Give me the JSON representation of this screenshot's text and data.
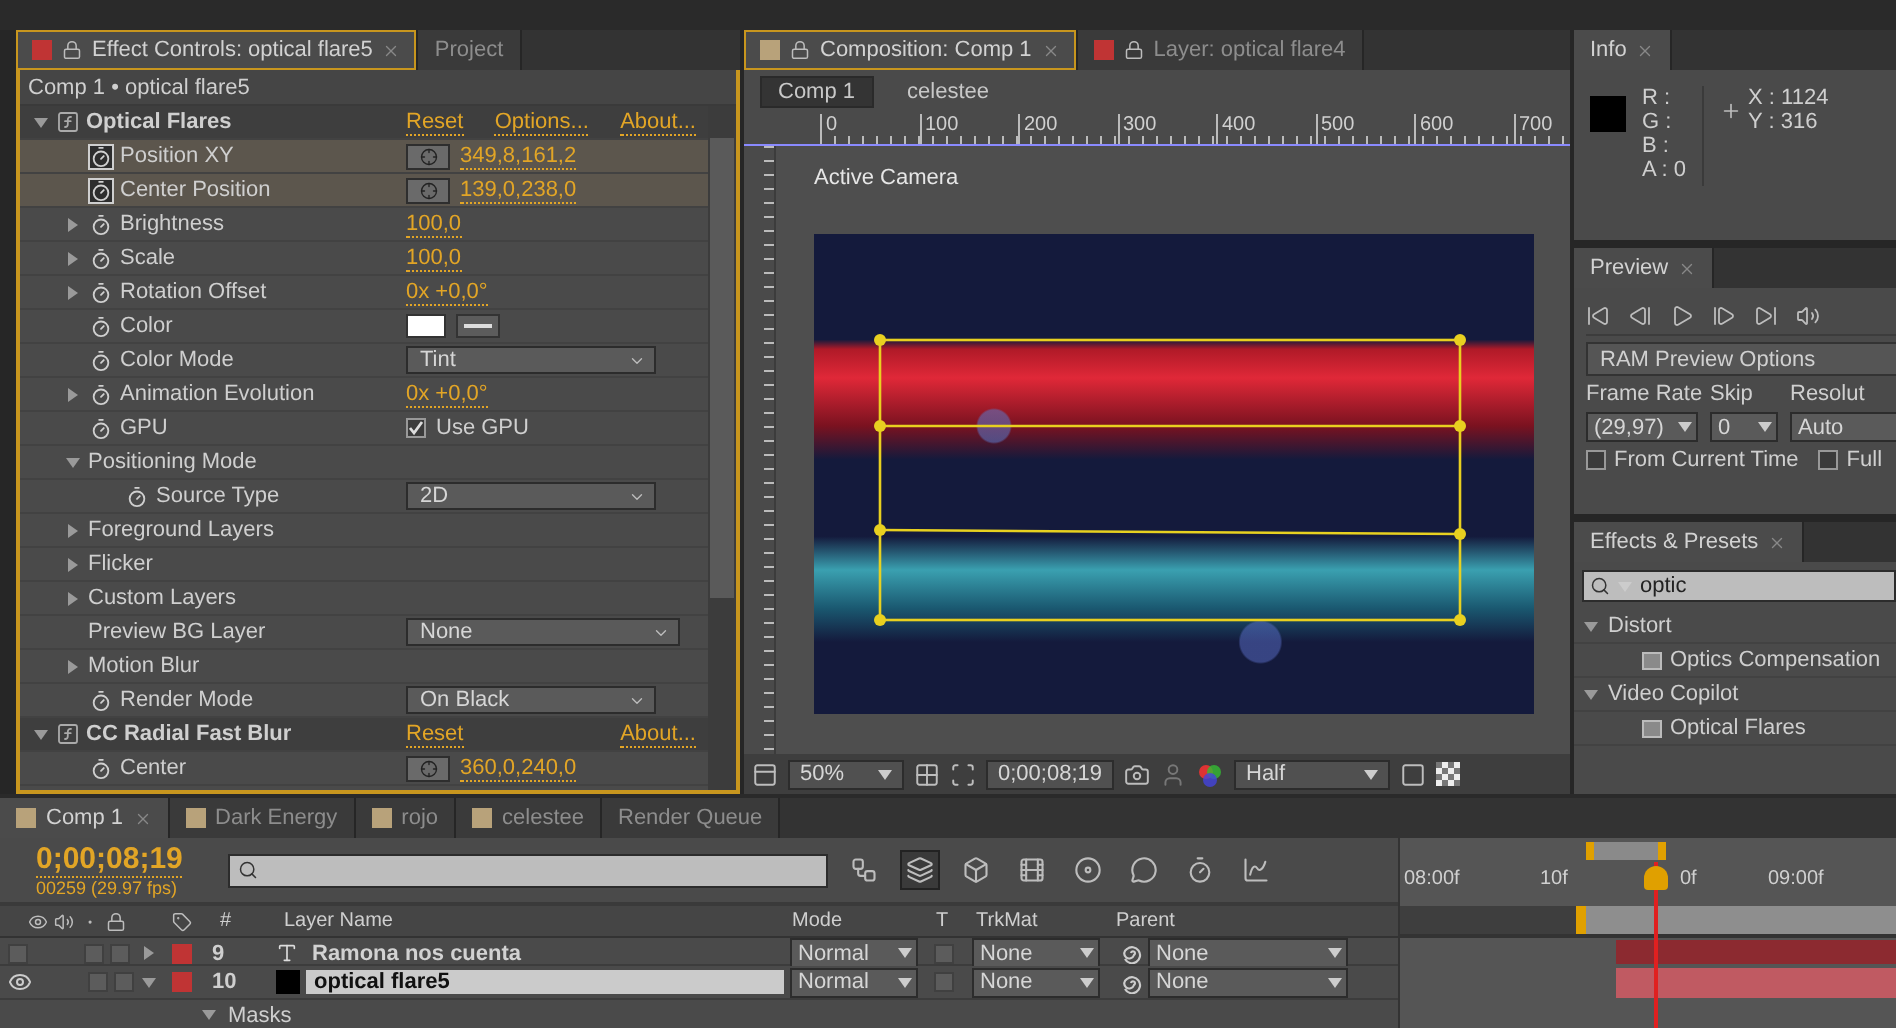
{
  "effect_controls": {
    "tabs": [
      {
        "label": "Effect Controls: optical flare5",
        "selected": true,
        "color": "#c03434"
      },
      {
        "label": "Project",
        "selected": false
      }
    ],
    "breadcrumb": "Comp 1 • optical flare5",
    "effects": [
      {
        "name": "Optical Flares",
        "expanded": true,
        "links": [
          "Reset",
          "Options...",
          "About..."
        ],
        "properties": [
          {
            "kind": "point",
            "label": "Position XY",
            "value": "349,8,161,2",
            "animatable": true,
            "keyframed": true,
            "selected": true
          },
          {
            "kind": "point",
            "label": "Center Position",
            "value": "139,0,238,0",
            "animatable": true,
            "keyframed": true,
            "selected": true
          },
          {
            "kind": "number",
            "label": "Brightness",
            "value": "100,0",
            "expanded": false,
            "animatable": true,
            "selected": false
          },
          {
            "kind": "number",
            "label": "Scale",
            "value": "100,0",
            "expanded": false,
            "animatable": true,
            "selected": false
          },
          {
            "kind": "number",
            "label": "Rotation Offset",
            "value": "0x +0,0°",
            "expanded": false,
            "animatable": true,
            "selected": false
          },
          {
            "kind": "color",
            "label": "Color",
            "animatable": true,
            "selected": false
          },
          {
            "kind": "dropdown",
            "label": "Color Mode",
            "value": "Tint",
            "animatable": true,
            "selected": false
          },
          {
            "kind": "number",
            "label": "Animation Evolution",
            "value": "0x +0,0°",
            "expanded": false,
            "animatable": true,
            "selected": false
          },
          {
            "kind": "checkbox",
            "label": "GPU",
            "value": "Use GPU",
            "checked": true,
            "animatable": true,
            "selected": false
          },
          {
            "kind": "group",
            "label": "Positioning Mode",
            "expanded": true,
            "selected": false,
            "children": [
              {
                "kind": "dropdown",
                "label": "Source Type",
                "value": "2D",
                "animatable": true,
                "selected": false
              }
            ]
          },
          {
            "kind": "group",
            "label": "Foreground Layers",
            "expanded": false,
            "selected": false
          },
          {
            "kind": "group",
            "label": "Flicker",
            "expanded": false,
            "selected": false
          },
          {
            "kind": "group",
            "label": "Custom Layers",
            "expanded": false,
            "selected": false
          },
          {
            "kind": "dropdown",
            "label": "Preview BG Layer",
            "value": "None",
            "animatable": false,
            "selected": false
          },
          {
            "kind": "group",
            "label": "Motion Blur",
            "expanded": false,
            "selected": false
          },
          {
            "kind": "dropdown",
            "label": "Render Mode",
            "value": "On Black",
            "animatable": true,
            "selected": false
          }
        ]
      },
      {
        "name": "CC Radial Fast Blur",
        "expanded": true,
        "links": [
          "Reset",
          "About..."
        ],
        "properties": [
          {
            "kind": "point",
            "label": "Center",
            "value": "360,0,240,0",
            "animatable": true,
            "selected": false
          }
        ]
      }
    ]
  },
  "composition": {
    "tabs": [
      {
        "label": "Composition: Comp 1",
        "selected": true,
        "color": "#b8a27a"
      },
      {
        "label": "Layer: optical flare4",
        "selected": false,
        "color": "#c03434"
      }
    ],
    "breadcrumbs": [
      {
        "label": "Comp 1",
        "selected": true
      },
      {
        "label": "celestee",
        "selected": false
      }
    ],
    "ruler": [
      "0",
      "100",
      "200",
      "300",
      "400",
      "500",
      "600",
      "700"
    ],
    "view_label": "Active Camera",
    "toolbar": {
      "zoom": "50%",
      "time": "0;00;08;19",
      "resolution": "Half"
    }
  },
  "info": {
    "tab": "Info",
    "channels": [
      "R :",
      "G :",
      "B :",
      "A : 0"
    ],
    "coords": [
      "X : 1124",
      "Y : 316"
    ]
  },
  "preview": {
    "tab": "Preview",
    "options_button": "RAM Preview Options",
    "fields": [
      {
        "label": "Frame Rate",
        "value": "(29,97)"
      },
      {
        "label": "Skip",
        "value": "0"
      },
      {
        "label": "Resolut",
        "value": "Auto"
      }
    ],
    "checkboxes": [
      {
        "label": "From Current Time",
        "checked": false
      },
      {
        "label": "Full",
        "checked": false
      }
    ]
  },
  "effects_presets": {
    "tab": "Effects & Presets",
    "search": "optic",
    "tree": [
      {
        "label": "Distort",
        "expanded": true,
        "children": [
          {
            "label": "Optics Compensation"
          }
        ]
      },
      {
        "label": "Video Copilot",
        "expanded": true,
        "children": [
          {
            "label": "Optical Flares"
          }
        ]
      }
    ]
  },
  "timeline": {
    "tabs": [
      {
        "label": "Comp 1",
        "selected": true,
        "color": "#b8a27a"
      },
      {
        "label": "Dark Energy",
        "selected": false,
        "color": "#b8a27a"
      },
      {
        "label": "rojo",
        "selected": false,
        "color": "#b8a27a"
      },
      {
        "label": "celestee",
        "selected": false,
        "color": "#b8a27a"
      },
      {
        "label": "Render Queue",
        "selected": false
      }
    ],
    "timecode": "0;00;08;19",
    "frame_info": "00259 (29.97 fps)",
    "columns": [
      "#",
      "Layer Name",
      "Mode",
      "T",
      "TrkMat",
      "Parent"
    ],
    "layers": [
      {
        "number": "9",
        "kind": "text",
        "name": "Ramona nos cuenta",
        "visible": false,
        "expanded": false,
        "selected": false,
        "color": "#c03434",
        "mode": "Normal",
        "trkmat": "None",
        "parent": "None"
      },
      {
        "number": "10",
        "kind": "solid",
        "name": "optical flare5",
        "visible": true,
        "expanded": true,
        "selected": true,
        "color": "#c03434",
        "mode": "Normal",
        "trkmat": "None",
        "parent": "None",
        "children": [
          {
            "label": "Masks",
            "expanded": true
          }
        ]
      }
    ],
    "ruler": [
      "08:00f",
      "10f",
      "0f",
      "09:00f"
    ]
  }
}
